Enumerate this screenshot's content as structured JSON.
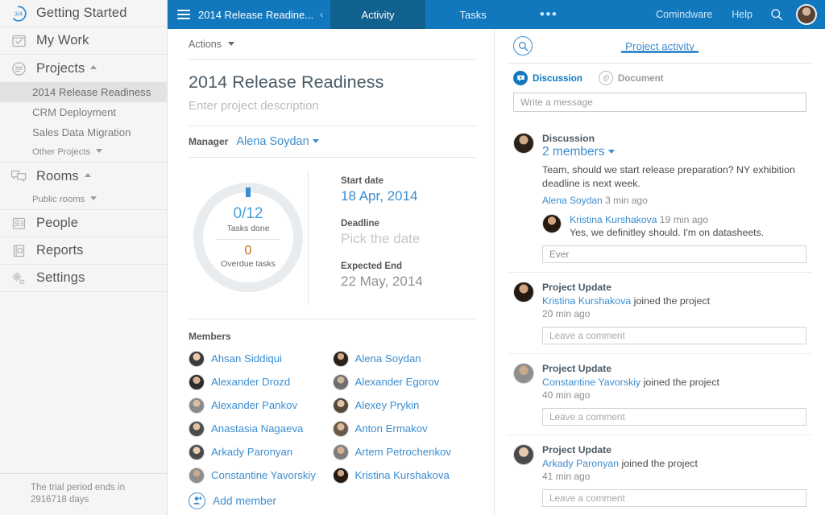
{
  "sidebar": {
    "items": [
      {
        "label": "Getting Started",
        "icon": "progress-badge-icon",
        "badge": "3/4"
      },
      {
        "label": "My Work",
        "icon": "checklist-icon"
      },
      {
        "label": "Projects",
        "icon": "list-circle-icon",
        "chevron": "up"
      },
      {
        "label": "Rooms",
        "icon": "chat-bubbles-icon",
        "chevron": "up"
      },
      {
        "label": "People",
        "icon": "id-card-icon"
      },
      {
        "label": "Reports",
        "icon": "book-icon"
      },
      {
        "label": "Settings",
        "icon": "gears-icon"
      }
    ],
    "projects": [
      {
        "label": "2014 Release Readiness",
        "active": true
      },
      {
        "label": "CRM Deployment",
        "active": false
      },
      {
        "label": "Sales Data Migration",
        "active": false
      }
    ],
    "other_projects": "Other Projects",
    "public_rooms": "Public rooms",
    "trial_notice": "The trial period ends in 2916718 days"
  },
  "topbar": {
    "project_name": "2014 Release Readine...",
    "collapse_icon": "chevron-left-icon",
    "menu_icon": "hamburger-icon",
    "tabs": [
      {
        "label": "Activity",
        "active": true
      },
      {
        "label": "Tasks",
        "active": false
      }
    ],
    "more_label": "•••",
    "brand": "Comindware",
    "help": "Help",
    "search_icon": "search-icon",
    "avatar": "user-avatar",
    "accent": "#1278be",
    "active_tab_bg": "#11618f"
  },
  "main": {
    "actions_label": "Actions",
    "project_title": "2014 Release Readiness",
    "project_description_placeholder": "Enter project description",
    "manager_label": "Manager",
    "manager_name": "Alena Soydan",
    "progress": {
      "tasks_done": "0/12",
      "tasks_done_label": "Tasks done",
      "overdue": "0",
      "overdue_label": "Overdue tasks",
      "percent": 0,
      "ring_color": "#e8ecef",
      "marker_color": "#3b8dd0"
    },
    "dates": [
      {
        "label": "Start date",
        "value": "18 Apr, 2014",
        "style": "link"
      },
      {
        "label": "Deadline",
        "value": "Pick the date",
        "style": "placeholder"
      },
      {
        "label": "Expected End",
        "value": "22 May, 2014",
        "style": "grey"
      }
    ],
    "members_label": "Members",
    "members": [
      {
        "name": "Ahsan Siddiqui",
        "face": "f1"
      },
      {
        "name": "Alena Soydan",
        "face": "f7"
      },
      {
        "name": "Alexander Drozd",
        "face": "f2"
      },
      {
        "name": "Alexander Egorov",
        "face": "f3"
      },
      {
        "name": "Alexander Pankov",
        "face": "f5"
      },
      {
        "name": "Alexey Prykin",
        "face": "f4"
      },
      {
        "name": "Anastasia Nagaeva",
        "face": "f9"
      },
      {
        "name": "Anton Ermakov",
        "face": "f8"
      },
      {
        "name": "Arkady Paronyan",
        "face": "f6"
      },
      {
        "name": "Artem Petrochenkov",
        "face": "f10"
      },
      {
        "name": "Constantine Yavorskiy",
        "face": "f11"
      },
      {
        "name": "Kristina Kurshakova",
        "face": "f12"
      }
    ],
    "add_member_label": "Add member"
  },
  "activity": {
    "tab_label": "Project activity",
    "search_icon": "search-icon",
    "post_tabs": [
      {
        "label": "Discussion",
        "icon": "chat-bubble-icon",
        "active": true
      },
      {
        "label": "Document",
        "icon": "paperclip-icon",
        "active": false
      }
    ],
    "message_placeholder": "Write a message",
    "feed": [
      {
        "kind": "Discussion",
        "members_link": "2 members",
        "text": "Team, should we start release preparation? NY exhibition deadline is next week.",
        "author": "Alena Soydan",
        "time": "3 min ago",
        "face": "f7",
        "reply": {
          "author": "Kristina Kurshakova",
          "time": "19 min ago",
          "text": "Yes, we definitley should. I'm on datasheets.",
          "face": "f12"
        },
        "comment_value": "Ever"
      },
      {
        "kind": "Project Update",
        "actor": "Kristina Kurshakova",
        "action": "joined the project",
        "time": "20 min ago",
        "face": "f12",
        "comment_placeholder": "Leave a comment"
      },
      {
        "kind": "Project Update",
        "actor": "Constantine Yavorskiy",
        "action": "joined the project",
        "time": "40 min ago",
        "face": "f11",
        "comment_placeholder": "Leave a comment"
      },
      {
        "kind": "Project Update",
        "actor": "Arkady Paronyan",
        "action": "joined the project",
        "time": "41 min ago",
        "face": "f6",
        "comment_placeholder": "Leave a comment"
      }
    ]
  }
}
